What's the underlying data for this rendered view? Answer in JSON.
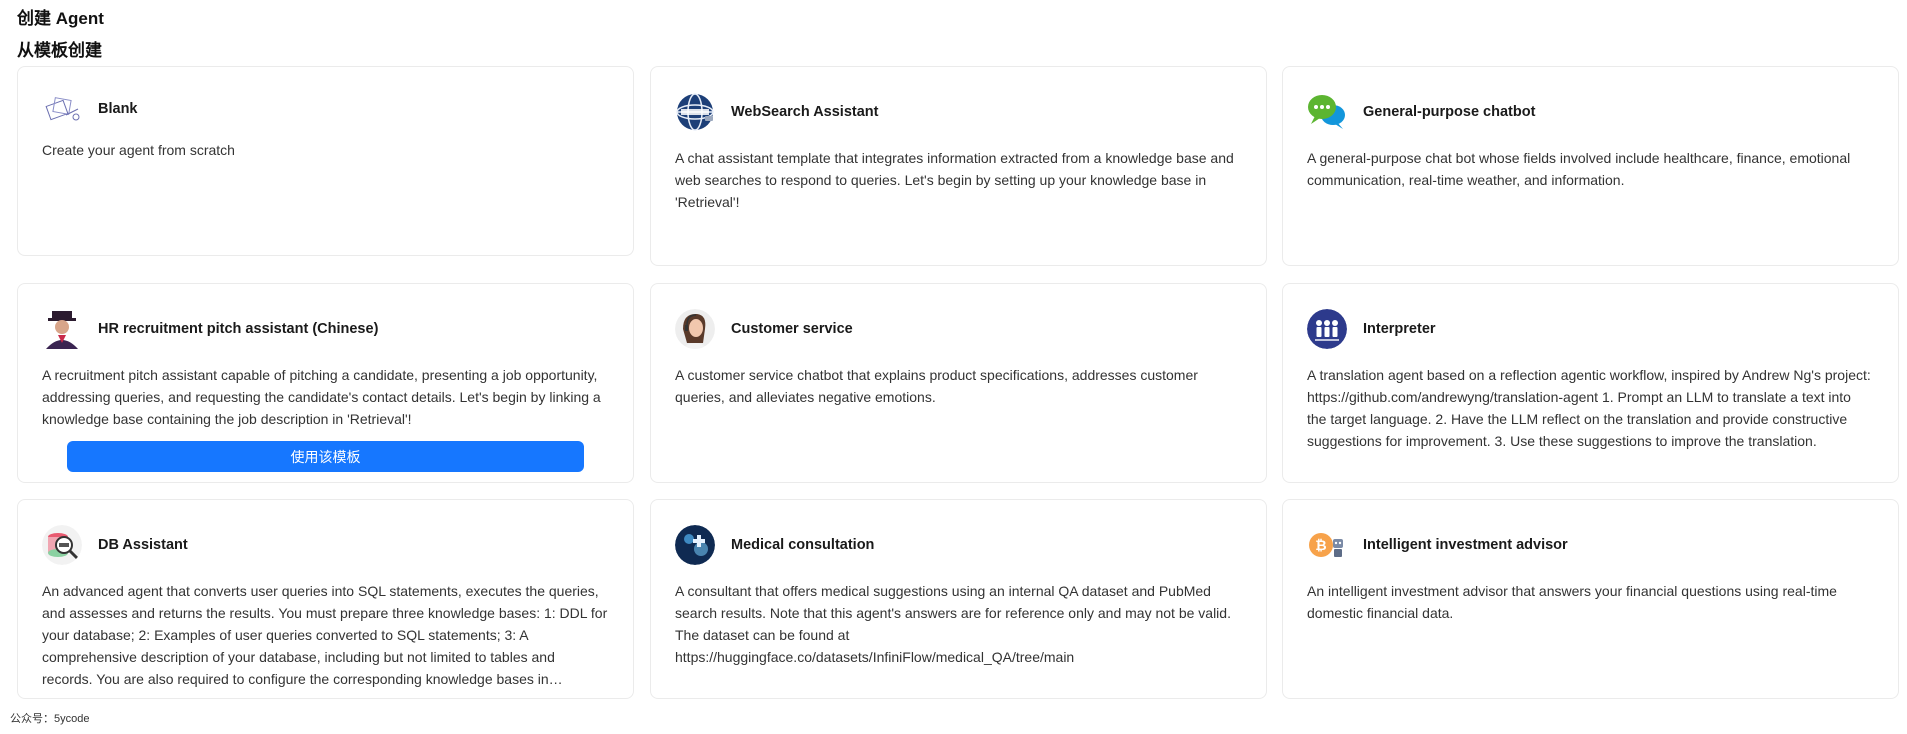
{
  "page": {
    "title": "创建 Agent",
    "subtitle": "从模板创建"
  },
  "cards": [
    {
      "title": "Blank",
      "icon": "blank-sketch-icon",
      "description": "Create your agent from scratch"
    },
    {
      "title": "WebSearch Assistant",
      "icon": "globe-icon",
      "description": "A chat assistant template that integrates information extracted from a knowledge base and web searches to respond to queries. Let's begin by setting up your knowledge base in 'Retrieval'!"
    },
    {
      "title": "General-purpose chatbot",
      "icon": "chat-bubbles-icon",
      "description": "A general-purpose chat bot whose fields involved include healthcare, finance, emotional communication, real-time weather, and information."
    },
    {
      "title": "HR recruitment pitch assistant (Chinese)",
      "icon": "recruiter-avatar-icon",
      "description": "A recruitment pitch assistant capable of pitching a candidate, presenting a job opportunity, addressing queries, and requesting the candidate's contact details. Let's begin by linking a knowledge base containing the job description in 'Retrieval'!"
    },
    {
      "title": "Customer service",
      "icon": "customer-service-avatar-icon",
      "description": "A customer service chatbot that explains product specifications, addresses customer queries, and alleviates negative emotions."
    },
    {
      "title": "Interpreter",
      "icon": "interpreter-people-icon",
      "description": "A translation agent based on a reflection agentic workflow, inspired by Andrew Ng's project: https://github.com/andrewyng/translation-agent 1. Prompt an LLM to translate a text into the target language. 2. Have the LLM reflect on the translation and provide constructive suggestions for improvement. 3. Use these suggestions to improve the translation."
    },
    {
      "title": "DB Assistant",
      "icon": "database-search-icon",
      "description": "An advanced agent that converts user queries into SQL statements, executes the queries, and assesses and returns the results. You must prepare three knowledge bases: 1: DDL for your database; 2: Examples of user queries converted to SQL statements; 3: A comprehensive description of your database, including but not limited to tables and records. You are also required to configure the corresponding knowledge bases in 'Retrieval'."
    },
    {
      "title": "Medical consultation",
      "icon": "medical-icon",
      "description": "A consultant that offers medical suggestions using an internal QA dataset and PubMed search results. Note that this agent's answers are for reference only and may not be valid. The dataset can be found at https://huggingface.co/datasets/InfiniFlow/medical_QA/tree/main"
    },
    {
      "title": "Intelligent investment advisor",
      "icon": "bitcoin-robot-icon",
      "description": "An intelligent investment advisor that answers your financial questions using real-time domestic financial data."
    }
  ],
  "hover_button_label": "使用该模板",
  "colors": {
    "primary": "#1677ff",
    "card_border": "#ebebeb"
  },
  "footer": "公众号：5ycode"
}
